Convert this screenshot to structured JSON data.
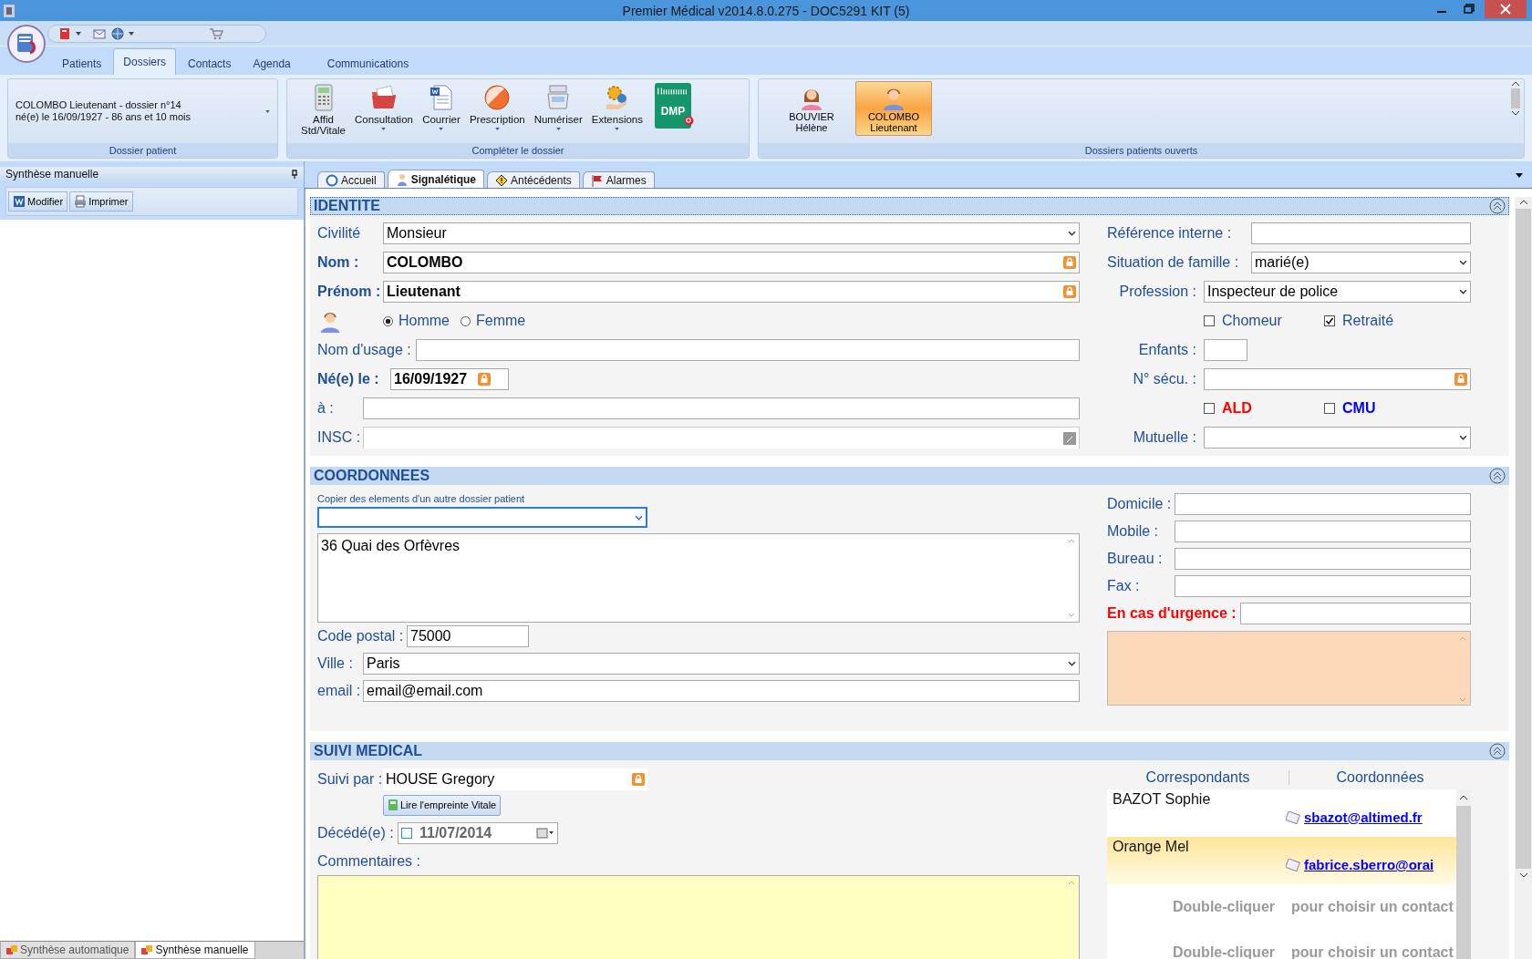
{
  "window": {
    "title": "Premier Médical v2014.8.0.275 - DOC5291 KIT (5)"
  },
  "ribbon_tabs": [
    {
      "label": "Patients",
      "selected": false
    },
    {
      "label": "Dossiers",
      "selected": true
    },
    {
      "label": "Contacts",
      "selected": false
    },
    {
      "label": "Agenda",
      "selected": false
    },
    {
      "label": "Communications",
      "selected": false
    }
  ],
  "ribbon": {
    "patient_group": {
      "lines": [
        "COLOMBO Lieutenant - dossier n°14",
        "né(e) le 16/09/1927 - 86 ans et 10 mois"
      ],
      "caption": "Dossier patient"
    },
    "complete_group": {
      "caption": "Compléter le dossier",
      "buttons": [
        {
          "label": "Affid\nStd/Vitale",
          "kind": "calculator",
          "dropdown": false
        },
        {
          "label": "Consultation",
          "kind": "folder",
          "dropdown": true
        },
        {
          "label": "Courrier",
          "kind": "document",
          "dropdown": true
        },
        {
          "label": "Prescription",
          "kind": "disc",
          "dropdown": true
        },
        {
          "label": "Numériser",
          "kind": "scanner",
          "dropdown": true
        },
        {
          "label": "Extensions",
          "kind": "gears",
          "dropdown": true
        },
        {
          "label": "DMP",
          "kind": "dmp",
          "dropdown": false
        }
      ]
    },
    "open_group": {
      "caption": "Dossiers patients ouverts",
      "patients": [
        {
          "name": "BOUVIER",
          "first_name": "Hélène",
          "kind": "female",
          "selected": false
        },
        {
          "name": "COLOMBO",
          "first_name": "Lieutenant",
          "kind": "male",
          "selected": true
        }
      ]
    }
  },
  "left_panel": {
    "title": "Synthèse manuelle",
    "buttons": [
      "Modifier",
      "Imprimer"
    ],
    "bottom_tabs": [
      {
        "label": "Synthèse automatique",
        "selected": false
      },
      {
        "label": "Synthèse manuelle",
        "selected": true
      }
    ]
  },
  "content_tabs": [
    {
      "label": "Accueil",
      "selected": false
    },
    {
      "label": "Signalétique",
      "selected": true
    },
    {
      "label": "Antécédents",
      "selected": false
    },
    {
      "label": "Alarmes",
      "selected": false
    }
  ],
  "identite": {
    "title": "IDENTITE",
    "civilite": {
      "label": "Civilité",
      "value": "Monsieur"
    },
    "nom": {
      "label": "Nom :",
      "value": "COLOMBO"
    },
    "prenom": {
      "label": "Prénom :",
      "value": "Lieutenant"
    },
    "sexe": [
      {
        "label": "Homme",
        "selected": true
      },
      {
        "label": "Femme",
        "selected": false
      }
    ],
    "nom_usage": {
      "label": "Nom d'usage :"
    },
    "naissance": {
      "label": "Né(e) le :",
      "value": "16/09/1927"
    },
    "lieu": {
      "label": "à :"
    },
    "insc": {
      "label": "INSC :"
    },
    "reference": {
      "label": "Référence interne :"
    },
    "situation": {
      "label": "Situation de famille :",
      "value": "marié(e)"
    },
    "profession": {
      "label": "Profession :",
      "value": "Inspecteur de police"
    },
    "statut": [
      {
        "label": "Chomeur",
        "checked": false
      },
      {
        "label": "Retraité",
        "checked": true
      }
    ],
    "enfants": {
      "label": "Enfants :"
    },
    "secu": {
      "label": "N° sécu.  :"
    },
    "couverture": [
      {
        "label": "ALD",
        "checked": false,
        "color": "#ff0000"
      },
      {
        "label": "CMU",
        "checked": false,
        "color": "#0000ff"
      }
    ],
    "mutuelle": {
      "label": "Mutuelle :"
    }
  },
  "coordonnees": {
    "title": "COORDONNEES",
    "copie": {
      "label": "Copier des elements d'un autre dossier patient"
    },
    "adresse": {
      "value": "36 Quai des Orfèvres"
    },
    "code_postal": {
      "label": "Code postal :",
      "value": "75000"
    },
    "ville": {
      "label": "Ville :",
      "value": "Paris"
    },
    "email": {
      "label": "email :",
      "value": "email@email.com"
    },
    "telephones": [
      {
        "label": "Domicile :"
      },
      {
        "label": "Mobile :"
      },
      {
        "label": "Bureau :"
      },
      {
        "label": "Fax :"
      }
    ],
    "urgence": {
      "label": "En cas d'urgence :"
    }
  },
  "suivi": {
    "title": "SUIVI MEDICAL",
    "suivi_par": {
      "label": "Suivi par :",
      "value": "HOUSE Gregory"
    },
    "vitale_button": "Lire l'empreinte Vitale",
    "deces": {
      "label": "Décédé(e) :",
      "value": "11/07/2014",
      "checked": false
    },
    "commentaires": {
      "label": "Commentaires :"
    },
    "columns": [
      "Correspondants",
      "Coordonnées"
    ],
    "correspondants": [
      {
        "name": "BAZOT Sophie",
        "email": "sbazot@altimed.fr",
        "selected": false
      },
      {
        "name": "Orange Mel",
        "email": "fabrice.sberro@orai",
        "selected": true
      }
    ],
    "hints": [
      {
        "action": "Double-cliquer",
        "text": "pour choisir un contact"
      },
      {
        "action": "Double-cliquer",
        "text": "pour choisir un contact"
      }
    ]
  }
}
